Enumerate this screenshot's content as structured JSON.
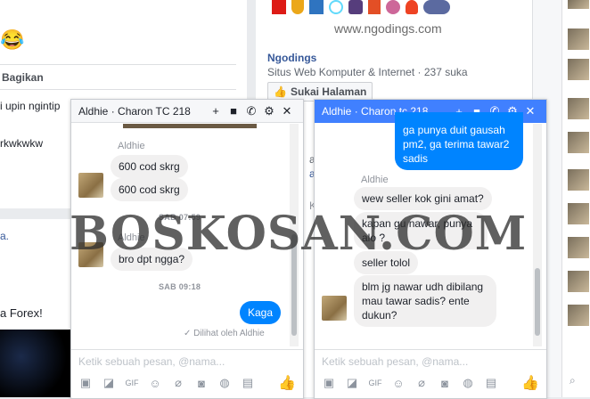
{
  "background": {
    "left_feed": {
      "bagikan": "Bagikan",
      "comment_1": "i upin ngintip",
      "comment_2": "rkwkwkw",
      "link_fragment": "a.",
      "forex_text": "a Forex!",
      "emoji": "😂"
    },
    "page_card": {
      "site_url": "www.ngodings.com",
      "page_name": "Ngodings",
      "page_meta": "Situs Web Komputer & Internet · 237 suka",
      "like_page_button": "Sukai Halaman",
      "tech_logos": [
        "angular",
        "gulp",
        "ts",
        "react",
        "bootstrap",
        "html5",
        "sass",
        "codeigniter",
        "php-mysql"
      ],
      "partial_1": "a I",
      "partial_2": "aw",
      "partial_3": "K"
    }
  },
  "chat_left": {
    "title": "Aldhie · Charon TC 218",
    "messages": {
      "sender_1": "Aldhie",
      "msg_1": "600 cod skrg",
      "msg_2": "600 cod skrg",
      "time_1": "SAB 07:59",
      "sender_2": "Aldhie",
      "msg_3": "bro dpt ngga?",
      "time_2": "SAB 09:18",
      "msg_4": "Kaga",
      "seen": "Dilihat oleh Aldhie"
    },
    "composer_placeholder": "Ketik sebuah pesan, @nama..."
  },
  "chat_right": {
    "title": "Aldhie · Charon tc 218",
    "messages": {
      "msg_1": "ga punya duit gausah pm2, ga terima tawar2 sadis",
      "sender_1": "Aldhie",
      "msg_2": "wew seller kok gini amat?",
      "msg_3": "kapan gu nawar, punya alo ?",
      "msg_4": "seller tolol",
      "msg_5": "blm jg nawar udh dibilang mau tawar sadis? ente dukun?"
    },
    "composer_placeholder": "Ketik sebuah pesan, @nama..."
  },
  "watermark": "BOSKOSAN.COM",
  "colors": {
    "chat_header_active": "#4080ff",
    "chat_header_inactive": "#f6f7f9",
    "my_bubble": "#0084ff"
  }
}
